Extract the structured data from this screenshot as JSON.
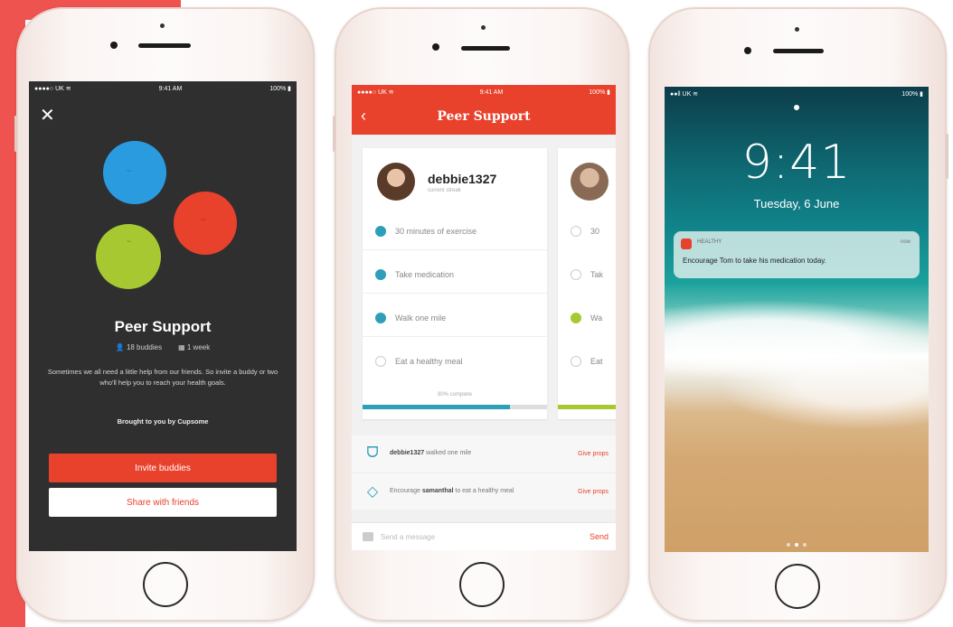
{
  "phone1": {
    "status": {
      "carrier": "●●●●○ UK ≋",
      "time": "9:41 AM",
      "battery": "100% ▮"
    },
    "close_label": "✕",
    "title": "Peer Support",
    "buddies": "18 buddies",
    "weeks": "1 week",
    "description": "Sometimes we all need a little help from our friends. So invite a buddy or two who'll help you to reach your health goals.",
    "brought_by": "Brought to you by Cupsome",
    "invite_button": "Invite buddies",
    "share_button": "Share with friends",
    "colors": {
      "blue": "#2b9be0",
      "red": "#e8412c",
      "lime": "#a8c832"
    }
  },
  "phone2": {
    "status": {
      "carrier": "●●●●○ UK ≋",
      "time": "9:41 AM",
      "battery": "100% ▮"
    },
    "back_label": "‹",
    "title": "Peer Support",
    "user": {
      "name": "debbie1327",
      "sub": "current streak"
    },
    "tasks": [
      {
        "label": "30 minutes of exercise",
        "done": true
      },
      {
        "label": "Take medication",
        "done": true
      },
      {
        "label": "Walk one mile",
        "done": true
      },
      {
        "label": "Eat a healthy meal",
        "done": false
      }
    ],
    "peer_tasks": [
      "30",
      "Tak",
      "Wa",
      "Eat"
    ],
    "progress_label": "80% complete",
    "progress_value": 0.8,
    "feed": [
      {
        "text_bold": "debbie1327",
        "text": " walked one mile",
        "link": "Give props"
      },
      {
        "text": "Encourage ",
        "text_bold": "samanthal",
        "text_after": " to eat a healthy meal",
        "link": "Give props"
      }
    ],
    "message_placeholder": "Send a message",
    "send_label": "Send",
    "accent": "#e8412c"
  },
  "phone3": {
    "status": {
      "carrier": "●●ll UK ≋",
      "time": "",
      "battery": "100% ▮"
    },
    "time": "9:41",
    "date": "Tuesday, 6 June",
    "notification": {
      "app": "HEALTHY",
      "when": "now",
      "text": "Encourage Tom to take his medication today."
    }
  }
}
